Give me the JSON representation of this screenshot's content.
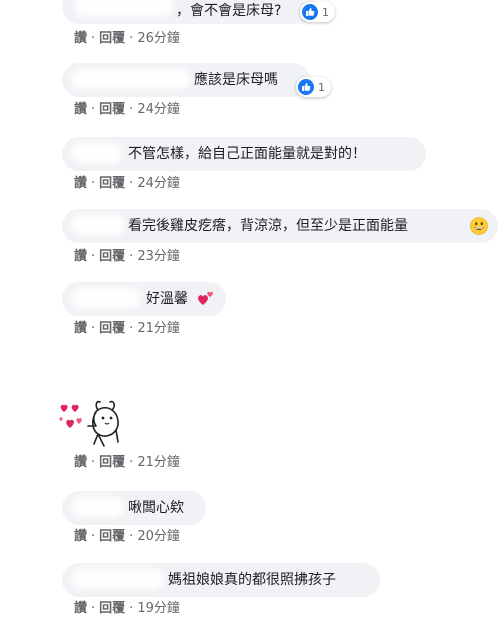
{
  "comments": [
    {
      "text": "，會不會是床母?",
      "reactions": "1",
      "like": "讚",
      "reply": "回覆",
      "time": "26分鐘"
    },
    {
      "text": "應該是床母嗎",
      "reactions": "1",
      "like": "讚",
      "reply": "回覆",
      "time": "24分鐘"
    },
    {
      "text": "不管怎樣，給自己正面能量就是對的！",
      "like": "讚",
      "reply": "回覆",
      "time": "24分鐘"
    },
    {
      "text": "看完後雞皮疙瘩，背涼涼，但至少是正面能量",
      "like": "讚",
      "reply": "回覆",
      "time": "23分鐘"
    },
    {
      "text": "好溫馨",
      "like": "讚",
      "reply": "回覆",
      "time": "21分鐘"
    },
    {
      "sticker": "hearts-bunny-sticker",
      "like": "讚",
      "reply": "回覆",
      "time": "21分鐘"
    },
    {
      "text": "啾闆心欸",
      "like": "讚",
      "reply": "回覆",
      "time": "20分鐘"
    },
    {
      "text": "媽祖娘娘真的都很照拂孩子",
      "like": "讚",
      "reply": "回覆",
      "time": "19分鐘"
    }
  ],
  "colors": {
    "bubble": "#f0f2f5",
    "text": "#1c1e21",
    "meta": "#65676b",
    "like_blue": "#1877f2",
    "heart_red": "#e0245e"
  },
  "icons": [
    "like-reaction-icon",
    "grinning-face-emoji-icon",
    "two-hearts-emoji-icon",
    "hearts-bunny-sticker"
  ]
}
